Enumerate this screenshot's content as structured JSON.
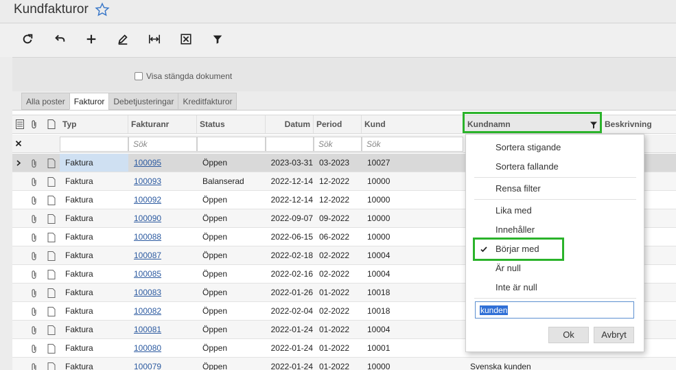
{
  "page": {
    "title": "Kundfakturor"
  },
  "toolbar": {
    "buttons": [
      "refresh-icon",
      "undo-icon",
      "add-icon",
      "edit-icon",
      "fit-columns-icon",
      "export-excel-icon",
      "filter-icon"
    ]
  },
  "filter": {
    "show_closed_label": "Visa stängda dokument"
  },
  "tabs": [
    {
      "label": "Alla poster"
    },
    {
      "label": "Fakturor"
    },
    {
      "label": "Debetjusteringar"
    },
    {
      "label": "Kreditfakturor"
    }
  ],
  "columns": {
    "typ": "Typ",
    "fakturanr": "Fakturanr",
    "status": "Status",
    "datum": "Datum",
    "period": "Period",
    "kund": "Kund",
    "kundnamn": "Kundnamn",
    "beskrivning": "Beskrivning"
  },
  "filter_row": {
    "fakturanr_placeholder": "Sök",
    "period_placeholder": "Sök",
    "kund_placeholder": "Sök"
  },
  "rows": [
    {
      "typ": "Faktura",
      "fakturanr": "100095",
      "status": "Öppen",
      "datum": "2023-03-31",
      "period": "03-2023",
      "kund": "10027"
    },
    {
      "typ": "Faktura",
      "fakturanr": "100093",
      "status": "Balanserad",
      "datum": "2022-12-14",
      "period": "12-2022",
      "kund": "10000"
    },
    {
      "typ": "Faktura",
      "fakturanr": "100092",
      "status": "Öppen",
      "datum": "2022-12-14",
      "period": "12-2022",
      "kund": "10000"
    },
    {
      "typ": "Faktura",
      "fakturanr": "100090",
      "status": "Öppen",
      "datum": "2022-09-07",
      "period": "09-2022",
      "kund": "10000"
    },
    {
      "typ": "Faktura",
      "fakturanr": "100088",
      "status": "Öppen",
      "datum": "2022-06-15",
      "period": "06-2022",
      "kund": "10000"
    },
    {
      "typ": "Faktura",
      "fakturanr": "100087",
      "status": "Öppen",
      "datum": "2022-02-18",
      "period": "02-2022",
      "kund": "10004"
    },
    {
      "typ": "Faktura",
      "fakturanr": "100085",
      "status": "Öppen",
      "datum": "2022-02-16",
      "period": "02-2022",
      "kund": "10004"
    },
    {
      "typ": "Faktura",
      "fakturanr": "100083",
      "status": "Öppen",
      "datum": "2022-01-26",
      "period": "01-2022",
      "kund": "10018"
    },
    {
      "typ": "Faktura",
      "fakturanr": "100082",
      "status": "Öppen",
      "datum": "2022-02-04",
      "period": "02-2022",
      "kund": "10018"
    },
    {
      "typ": "Faktura",
      "fakturanr": "100081",
      "status": "Öppen",
      "datum": "2022-01-24",
      "period": "01-2022",
      "kund": "10004"
    },
    {
      "typ": "Faktura",
      "fakturanr": "100080",
      "status": "Öppen",
      "datum": "2022-01-24",
      "period": "01-2022",
      "kund": "10001"
    },
    {
      "typ": "Faktura",
      "fakturanr": "100079",
      "status": "Öppen",
      "datum": "2022-01-24",
      "period": "01-2022",
      "kund": "10000",
      "kundnamn": "Svenska kunden"
    }
  ],
  "column_menu": {
    "sort_asc": "Sortera stigande",
    "sort_desc": "Sortera fallande",
    "clear_filter": "Rensa filter",
    "equals": "Lika med",
    "contains": "Innehåller",
    "starts_with": "Börjar med",
    "is_null": "Är null",
    "is_not_null": "Inte är null",
    "filter_value": "kunden",
    "ok": "Ok",
    "cancel": "Avbryt"
  },
  "colors": {
    "highlight": "#2ab32a",
    "link": "#2c5aa0",
    "selection": "#2f6fd6"
  }
}
